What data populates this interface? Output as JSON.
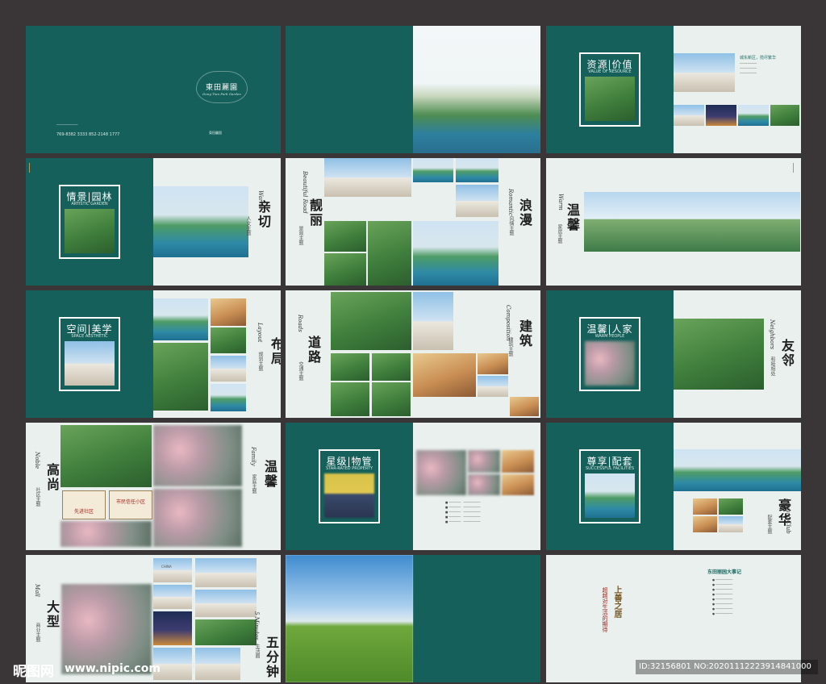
{
  "cover": {
    "logo_title": "東田麗園",
    "logo_sub": "Dong Tian Park Garden",
    "phone": "769-8382 3333  852-2148 1777"
  },
  "p3": {
    "title": "资源|价值",
    "sub": "VALUE OF RESOURCE",
    "caption": "城东新区，揽尽繁华"
  },
  "p4": {
    "title": "情景|园林",
    "sub": "ARTISTIC GARDEN",
    "v_title": "亲切",
    "v_sub": "人文主题",
    "e_title": "Warm"
  },
  "p5": {
    "v_title1": "靓丽",
    "v_sub1": "景观主题",
    "e_title1": "Beautiful Road",
    "v_title2": "浪漫",
    "v_sub2": "风情主题",
    "e_title2": "Romantic"
  },
  "p6": {
    "v_title": "温馨",
    "v_sub": "家居主题",
    "e_title": "Warm"
  },
  "p7": {
    "title": "空间|美学",
    "sub": "SPACE AESTHETIC",
    "v_title": "布局",
    "v_sub": "规划主题",
    "e_title": "Layout"
  },
  "p8": {
    "v_title1": "道路",
    "v_sub1": "交通主题",
    "e_title1": "Roads",
    "v_title2": "建筑",
    "v_sub2": "建筑主题",
    "e_title2": "Composition"
  },
  "p9": {
    "title": "温馨|人家",
    "sub": "WARM PEOPLE",
    "v_title": "友邻",
    "v_sub": "和睦相处",
    "e_title": "Neighbors"
  },
  "p10": {
    "v_title1": "高尚",
    "v_sub1": "社区主题",
    "e_title1": "Noble",
    "v_title2": "温馨",
    "v_sub2": "家庭主题",
    "e_title2": "Family",
    "plaque1": "先进社区",
    "plaque2": "市民信任小区"
  },
  "p11": {
    "title": "星级|物管",
    "sub": "STAR-RATED PROPERTY"
  },
  "p12": {
    "title": "尊享|配套",
    "sub": "SUCCESSFUL FACILITIES",
    "v_title": "豪华",
    "v_sub": "配套主题",
    "e_title": "Luxury Club"
  },
  "p13": {
    "v_title1": "大型",
    "v_sub1": "商业主题",
    "e_title1": "Mall",
    "v_title2": "五分钟",
    "v_sub2": "生活圈",
    "e_title2": "5 Minutes",
    "sign": "CHINA"
  },
  "p15": {
    "event_title": "东田丽园大事记",
    "calli_big": "上善之居",
    "calli_small": "超越对生活的期待"
  },
  "watermark": {
    "site": "昵图网",
    "url": "www.nipic.com",
    "id": "ID:32156801 NO:20201112223914841000"
  },
  "colors": {
    "teal": "#15605b",
    "page": "#e9f0ee",
    "background": "#3a3638"
  }
}
